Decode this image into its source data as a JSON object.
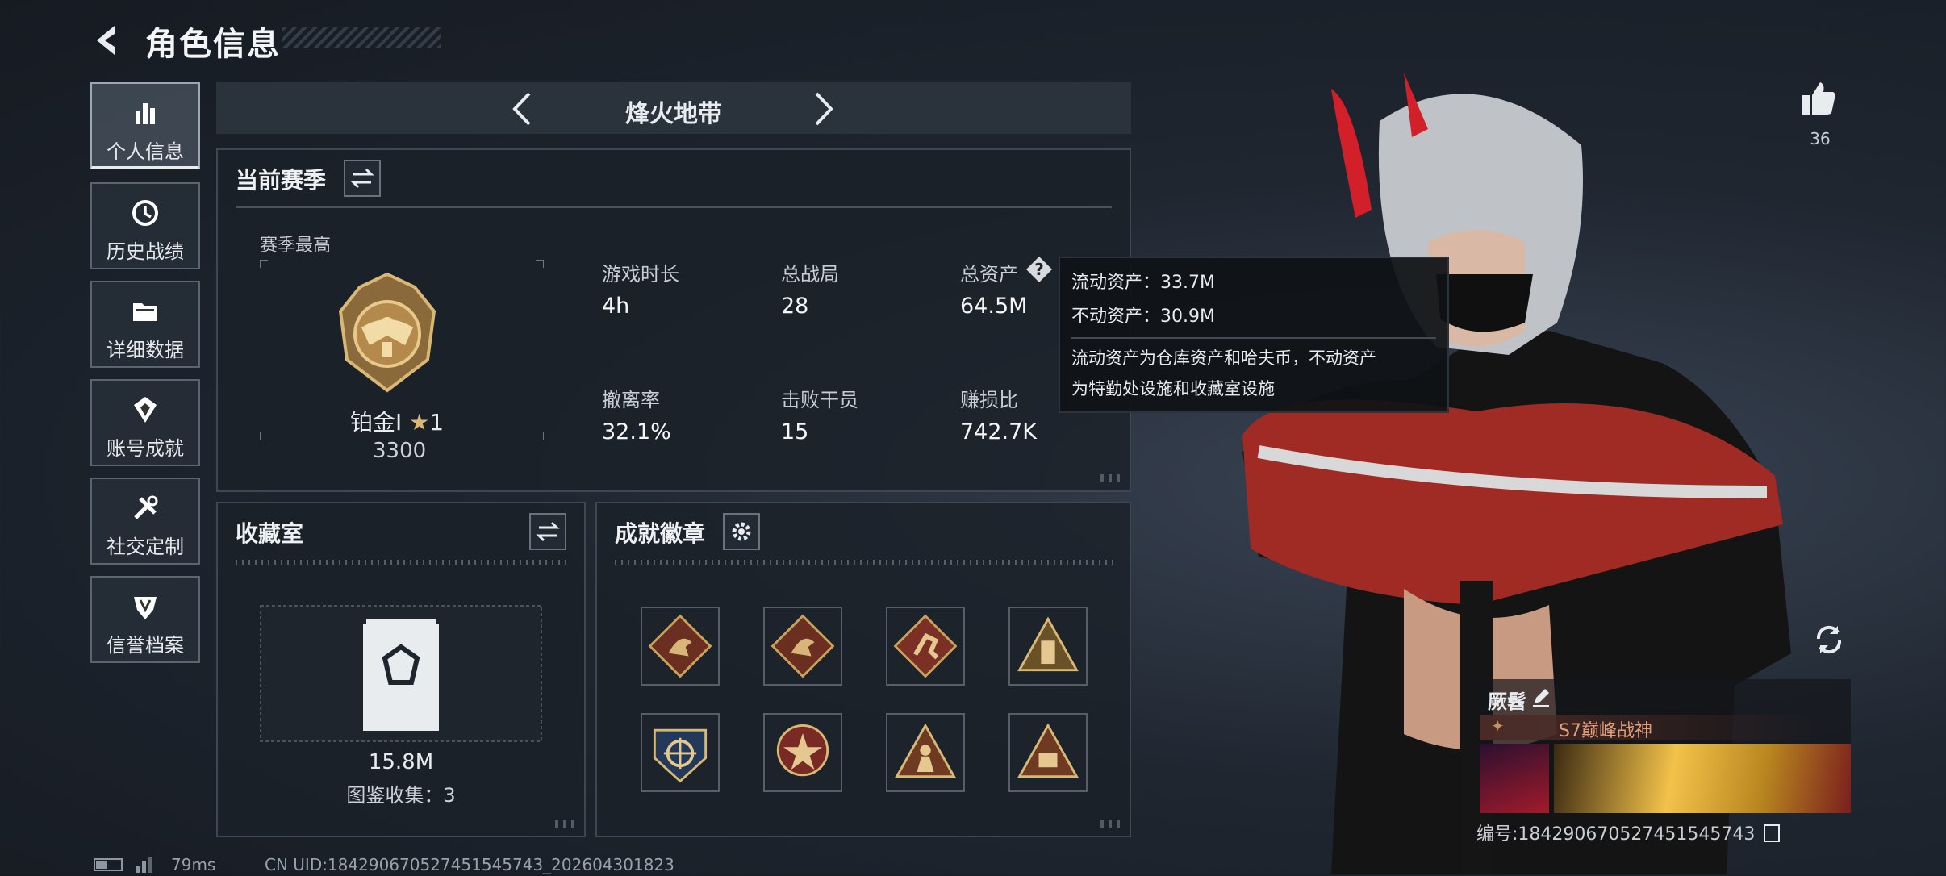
{
  "header": {
    "title": "角色信息"
  },
  "nav": {
    "items": [
      {
        "label": "个人信息",
        "icon": "bar-chart-icon",
        "active": true
      },
      {
        "label": "历史战绩",
        "icon": "history-clock-icon"
      },
      {
        "label": "详细数据",
        "icon": "folder-icon"
      },
      {
        "label": "账号成就",
        "icon": "achievement-icon"
      },
      {
        "label": "社交定制",
        "icon": "tools-icon"
      },
      {
        "label": "信誉档案",
        "icon": "shield-rank-icon"
      }
    ]
  },
  "mode": {
    "name": "烽火地带"
  },
  "season": {
    "title": "当前赛季",
    "best_label": "赛季最高",
    "rank_name": "铂金Ⅰ",
    "rank_stars": "1",
    "rank_points": "3300",
    "stats": [
      {
        "label": "游戏时长",
        "value": "4h"
      },
      {
        "label": "总战局",
        "value": "28"
      },
      {
        "label": "总资产",
        "value": "64.5M"
      },
      {
        "label": "撤离率",
        "value": "32.1%"
      },
      {
        "label": "击败干员",
        "value": "15"
      },
      {
        "label": "赚损比",
        "value": "742.7K"
      }
    ]
  },
  "tooltip": {
    "liquid": "流动资产：33.7M",
    "fixed": "不动资产：30.9M",
    "desc_line1": "流动资产为仓库资产和哈夫币，不动资产",
    "desc_line2": "为特勤处设施和收藏室设施"
  },
  "collection": {
    "title": "收藏室",
    "value": "15.8M",
    "count_text": "图鉴收集：3"
  },
  "achievements": {
    "title": "成就徽章",
    "badges": [
      "dragon-badge-icon",
      "dragon-badge-icon",
      "runner-badge-icon",
      "tower-badge-icon",
      "crosshair-shield-badge-icon",
      "star-shield-badge-icon",
      "soldier-triangle-badge-icon",
      "number-triangle-badge-icon"
    ]
  },
  "social": {
    "likes": "36"
  },
  "player": {
    "name": "厥髫",
    "title": "S7巅峰战神",
    "id_text": "编号:1842906705274515457​43"
  },
  "footer": {
    "ping": "79ms",
    "uid": "CN UID:18429067052745154574​3_202604301823"
  },
  "colors": {
    "accent": "#e9ecef",
    "panel": "#1b2128",
    "gold": "#c8a25a"
  }
}
